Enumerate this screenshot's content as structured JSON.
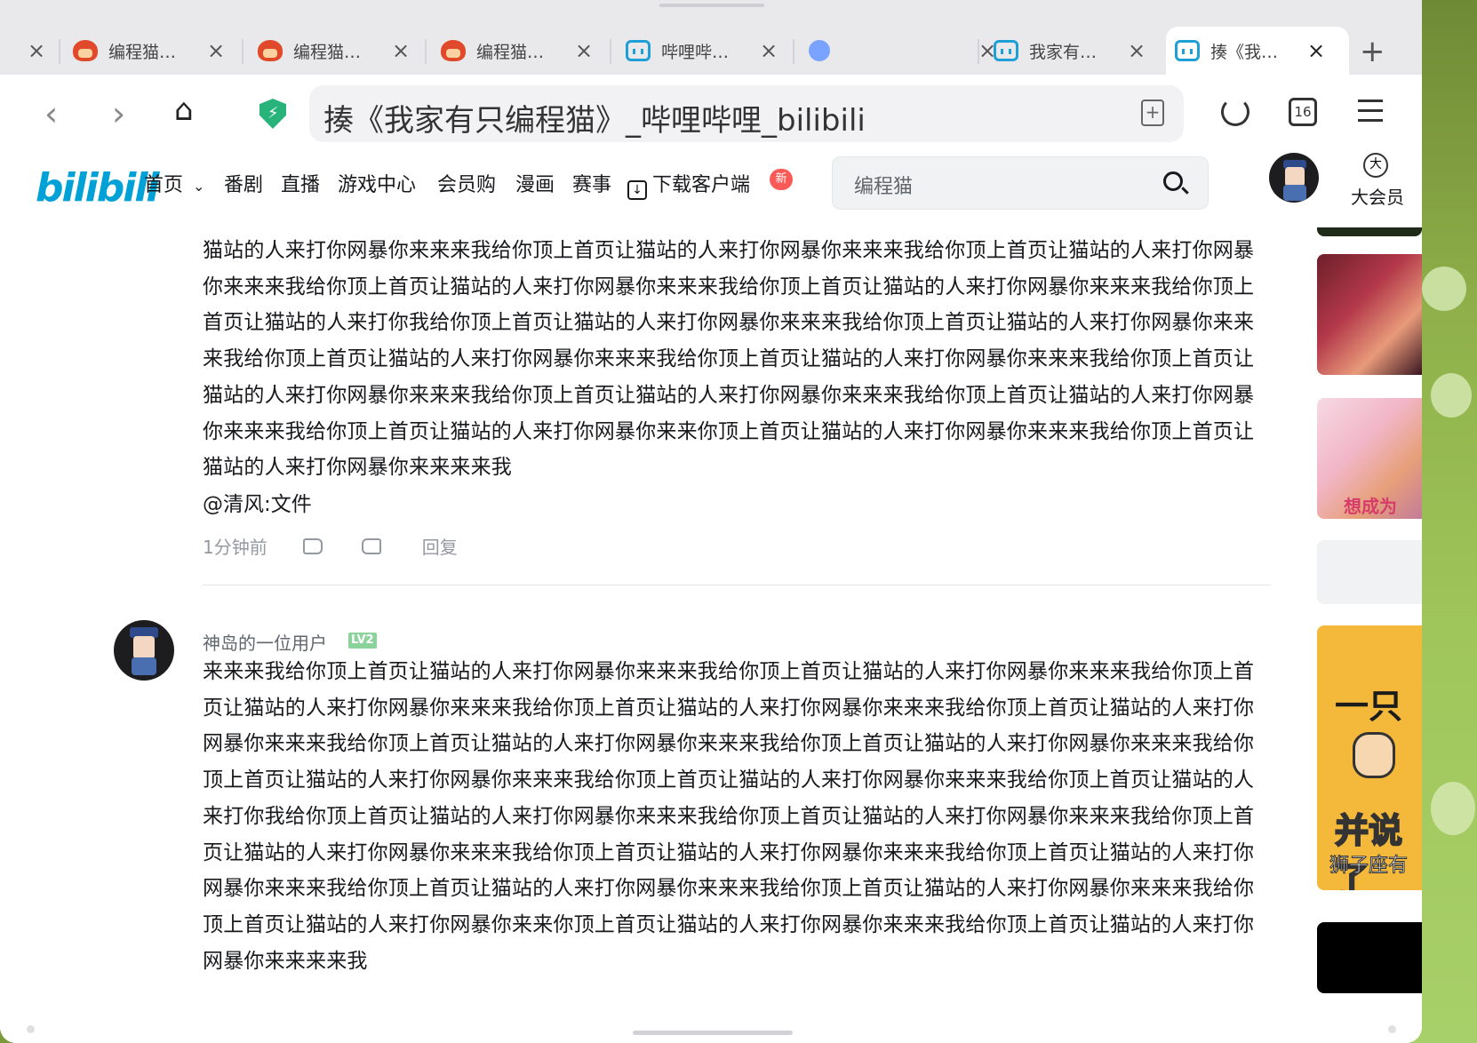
{
  "browser": {
    "tabs": [
      {
        "label": "编程猫…",
        "icon": "codemao-icon"
      },
      {
        "label": "编程猫…",
        "icon": "codemao-icon"
      },
      {
        "label": "编程猫…",
        "icon": "codemao-icon"
      },
      {
        "label": "哔哩哔…",
        "icon": "bilibili-icon"
      },
      {
        "label": "",
        "icon": "link-icon"
      },
      {
        "label": "我家有…",
        "icon": "bilibili-icon"
      },
      {
        "label": "揍《我…",
        "icon": "bilibili-icon",
        "active": true
      }
    ],
    "address_text": "揍《我家有只编程猫》_哔哩哔哩_bilibili",
    "tab_count": "16"
  },
  "site": {
    "logo": "bilibili",
    "nav": [
      "首页",
      "番剧",
      "直播",
      "游戏中心",
      "会员购",
      "漫画",
      "赛事",
      "下载客户端"
    ],
    "nav_new_badge": "新",
    "search_placeholder": "编程猫",
    "vip_icon_char": "大",
    "vip_label": "大会员"
  },
  "comments": [
    {
      "text": "猫站的人来打你网暴你来来来我给你顶上首页让猫站的人来打你网暴你来来来我给你顶上首页让猫站的人来打你网暴你来来来我给你顶上首页让猫站的人来打你网暴你来来来我给你顶上首页让猫站的人来打你网暴你来来来我给你顶上首页让猫站的人来打你我给你顶上首页让猫站的人来打你网暴你来来来我给你顶上首页让猫站的人来打你网暴你来来来我给你顶上首页让猫站的人来打你网暴你来来来我给你顶上首页让猫站的人来打你网暴你来来来我给你顶上首页让猫站的人来打你网暴你来来来我给你顶上首页让猫站的人来打你网暴你来来来我给你顶上首页让猫站的人来打你网暴你来来来我给你顶上首页让猫站的人来打你网暴你来来你顶上首页让猫站的人来打你网暴你来来来我给你顶上首页让猫站的人来打你网暴你来来来来我",
      "mention": "@清风:文件",
      "time": "1分钟前",
      "reply_label": "回复"
    },
    {
      "username": "神岛的一位用户",
      "level": "LV2",
      "text": "来来来我给你顶上首页让猫站的人来打你网暴你来来来我给你顶上首页让猫站的人来打你网暴你来来来我给你顶上首页让猫站的人来打你网暴你来来来我给你顶上首页让猫站的人来打你网暴你来来来我给你顶上首页让猫站的人来打你网暴你来来来我给你顶上首页让猫站的人来打你网暴你来来来我给你顶上首页让猫站的人来打你网暴你来来来我给你顶上首页让猫站的人来打你网暴你来来来我给你顶上首页让猫站的人来打你网暴你来来来我给你顶上首页让猫站的人来打你我给你顶上首页让猫站的人来打你网暴你来来来我给你顶上首页让猫站的人来打你网暴你来来来我给你顶上首页让猫站的人来打你网暴你来来来我给你顶上首页让猫站的人来打你网暴你来来来我给你顶上首页让猫站的人来打你网暴你来来来我给你顶上首页让猫站的人来打你网暴你来来来我给你顶上首页让猫站的人来打你网暴你来来来我给你顶上首页让猫站的人来打你网暴你来来你顶上首页让猫站的人来打你网暴你来来来我给你顶上首页让猫站的人来打你网暴你来来来来我"
    }
  ],
  "sidebar": {
    "card2_tag": "想成为",
    "card4_line1": "一只",
    "card4_line2": "并说了",
    "card4_caption": "狮子座有"
  }
}
